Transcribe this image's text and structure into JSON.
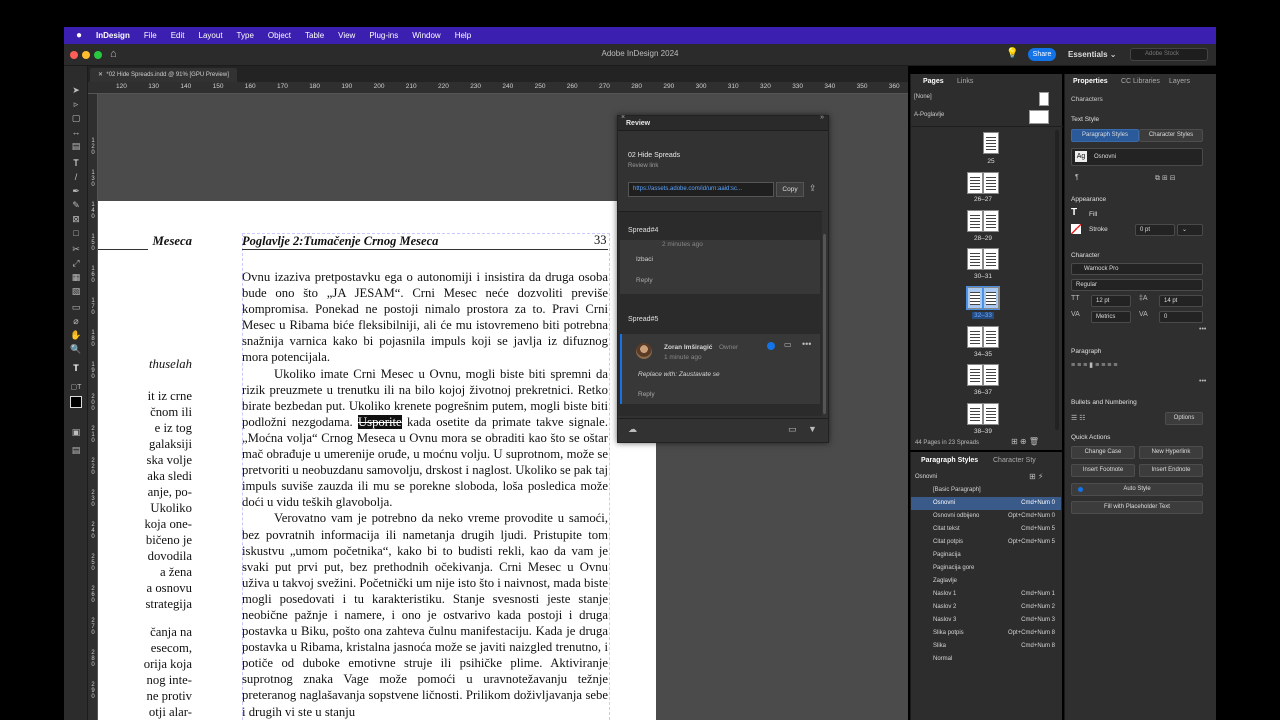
{
  "menubar": {
    "apple_icon": "apple-icon",
    "items": [
      "InDesign",
      "File",
      "Edit",
      "Layout",
      "Type",
      "Object",
      "Table",
      "View",
      "Plug-ins",
      "Window",
      "Help"
    ]
  },
  "window": {
    "title": "Adobe InDesign 2024",
    "share_label": "Share",
    "workspace_label": "Essentials",
    "stock_placeholder": "Adobe Stock"
  },
  "document": {
    "tab_label": "*02 Hide Spreads.indd @ 91% [GPU Preview]",
    "ruler_ticks": [
      "120",
      "130",
      "140",
      "150",
      "160",
      "170",
      "180",
      "190",
      "200",
      "210",
      "220",
      "230",
      "240",
      "250",
      "260",
      "270",
      "280",
      "290",
      "300",
      "310",
      "320",
      "330",
      "340",
      "350",
      "360"
    ],
    "running_head": "Poglavlje 2:Tumačenje Crnog Meseca",
    "page_number": "33",
    "left_page_lines": [
      "Meseca",
      "thuselah",
      "it iz crne",
      "čnom ili",
      "e iz tog",
      "galaksiji",
      "ska volje",
      "aka sledi",
      "anje, po-",
      "Ukoliko",
      "koja one-",
      "bičeno je",
      "dovodila",
      "a žena",
      "a osnovu",
      "strategija",
      "čanja na",
      "esecom,",
      "orija koja",
      "nog inte-",
      "ne protiv",
      "otji alar-"
    ],
    "para1_pre": "Ovnu izaziva pretpostavku ega o autonomiji i insistira da druga osoba bude ono što „JA JESAM“. Crni Mesec neće dozvoliti pre­više kompromisa. Ponekad ne postoji nimalo prostora za to. Pravi Crni Mesec u Ribama biće fleksibilniji, ali će mu istovremeno biti potrebna snažnija varnica kako bi pojasnila impuls koji se javlja iz difuznog mora potencijala.",
    "para2_pre": "Ukoliko imate Crni Mesec u Ovnu, mogli biste biti spremni da rizik preuzmete u trenutku ili na bilo kojoj životnoj prekretni­ci. Retko birate bezbedan put. Ukoliko krenete pogrešnim putem, mogli biste biti podložni nezgodama. ",
    "para2_highlight": "Usporite",
    "para2_post": " kada osetite da pri­mate takve signale. „Moćna volja“ Crnog Meseca u Ovnu mora se obraditi kao što se oštar mač obrađuje u umerenije oruđe, u moćnu volju. U suprotnom, može se pretvoriti u neobuzdanu sa­movolju, drskost i naglost. Ukoliko se pak taj impuls suviše zauzda ili mu se porekne sloboda, loša posledica može doći u vidu teških glavobolja.",
    "para3": "Verovatno vam je potrebno da neko vreme provodite u sa­moći, bez povratnih informacija ili nametanja drugih ljudi. Pri­stupite tom iskustvu „umom početnika“, kako bi to budisti rekli, kao da vam je svaki put prvi put, bez prethodnih očekivanja. Crni Mesec u Ovnu uživa u takvoj svežini. Početnički um nije isto što i naivnost, mada biste mogli posedovati i tu karakteristiku. Stanje svesnosti jeste stanje neobične pažnje i namere, i ono je ostvarivo kada postoji i druga postavka u Biku, pošto ona zahteva čulnu manifestaciju. Kada je druga postavka u Ribama, kristalna jasno­ća može se javiti naizgled trenutno, i potiče od duboke emotivne struje ili psihičke plime. Aktiviranje suprotnog znaka Vage može pomoći u uravnotežavanju težnje preteranog naglašavanja sop­stvene ličnosti. Prilikom doživljavanja sebe i drugih vi ste u stanju"
  },
  "review": {
    "panel_title": "Review",
    "doc_title": "02 Hide Spreads",
    "doc_subtitle": "Review link",
    "link": "https://assets.adobe.com/id/urn:aaid:sc...",
    "copy_label": "Copy",
    "spread4_label": "Spread#4",
    "spread4_time": "2 minutes ago",
    "spread4_comment": "Izbaci",
    "spread4_reply": "Reply",
    "spread5_label": "Spread#5",
    "author": "Zoran Imširagić",
    "author_role": "Owner",
    "spread5_time": "1 minute ago",
    "spread5_comment": "Replace with: Zaustavate se",
    "spread5_reply": "Reply"
  },
  "pages_panel": {
    "tabs": [
      "Pages",
      "Links"
    ],
    "masters": [
      "[None]",
      "A-Poglavlje"
    ],
    "spreads": [
      "25",
      "26–27",
      "28–29",
      "30–31",
      "32–33",
      "34–35",
      "36–37",
      "38–39"
    ],
    "selected_spread": "32–33",
    "status": "44 Pages in 23 Spreads"
  },
  "para_styles_panel": {
    "tabs": [
      "Paragraph Styles",
      "Character Sty"
    ],
    "current": "Osnovni",
    "rows": [
      {
        "name": "[Basic Paragraph]",
        "shortcut": ""
      },
      {
        "name": "Osnovni",
        "shortcut": "Cmd+Num 0"
      },
      {
        "name": "Osnovni odbijeno",
        "shortcut": "Opt+Cmd+Num 0"
      },
      {
        "name": "Citat tekst",
        "shortcut": "Cmd+Num 5"
      },
      {
        "name": "Citat potpis",
        "shortcut": "Opt+Cmd+Num 5"
      },
      {
        "name": "Paginacija",
        "shortcut": ""
      },
      {
        "name": "Paginacija gore",
        "shortcut": ""
      },
      {
        "name": "Zaglavlje",
        "shortcut": ""
      },
      {
        "name": "Naslov 1",
        "shortcut": "Cmd+Num 1"
      },
      {
        "name": "Naslov 2",
        "shortcut": "Cmd+Num 2"
      },
      {
        "name": "Naslov 3",
        "shortcut": "Cmd+Num 3"
      },
      {
        "name": "Slika potpis",
        "shortcut": "Opt+Cmd+Num 8"
      },
      {
        "name": "Slika",
        "shortcut": "Cmd+Num 8"
      },
      {
        "name": "Normal",
        "shortcut": ""
      }
    ],
    "selected_row": "Osnovni"
  },
  "properties": {
    "tabs": [
      "Properties",
      "CC Libraries",
      "Layers"
    ],
    "context": "Characters",
    "text_style_label": "Text Style",
    "para_styles_btn": "Paragraph Styles",
    "char_styles_btn": "Character Styles",
    "style_value": "Osnovni",
    "appearance_label": "Appearance",
    "fill_label": "Fill",
    "stroke_label": "Stroke",
    "stroke_value": "0 pt",
    "character_label": "Character",
    "font": "Warnock Pro",
    "font_style": "Regular",
    "font_size": "12 pt",
    "leading": "14 pt",
    "kerning": "Metrics",
    "tracking": "0",
    "paragraph_label": "Paragraph",
    "bullets_label": "Bullets and Numbering",
    "options_btn": "Options",
    "quick_actions_label": "Quick Actions",
    "change_case": "Change Case",
    "new_hyperlink": "New Hyperlink",
    "insert_footnote": "Insert Footnote",
    "insert_endnote": "Insert Endnote",
    "auto_style": "Auto Style",
    "fill_placeholder": "Fill with Placeholder Text"
  },
  "colors": {
    "menubar": "#3a1fb0",
    "accent": "#1473e6",
    "selection": "#3a5a8a"
  }
}
